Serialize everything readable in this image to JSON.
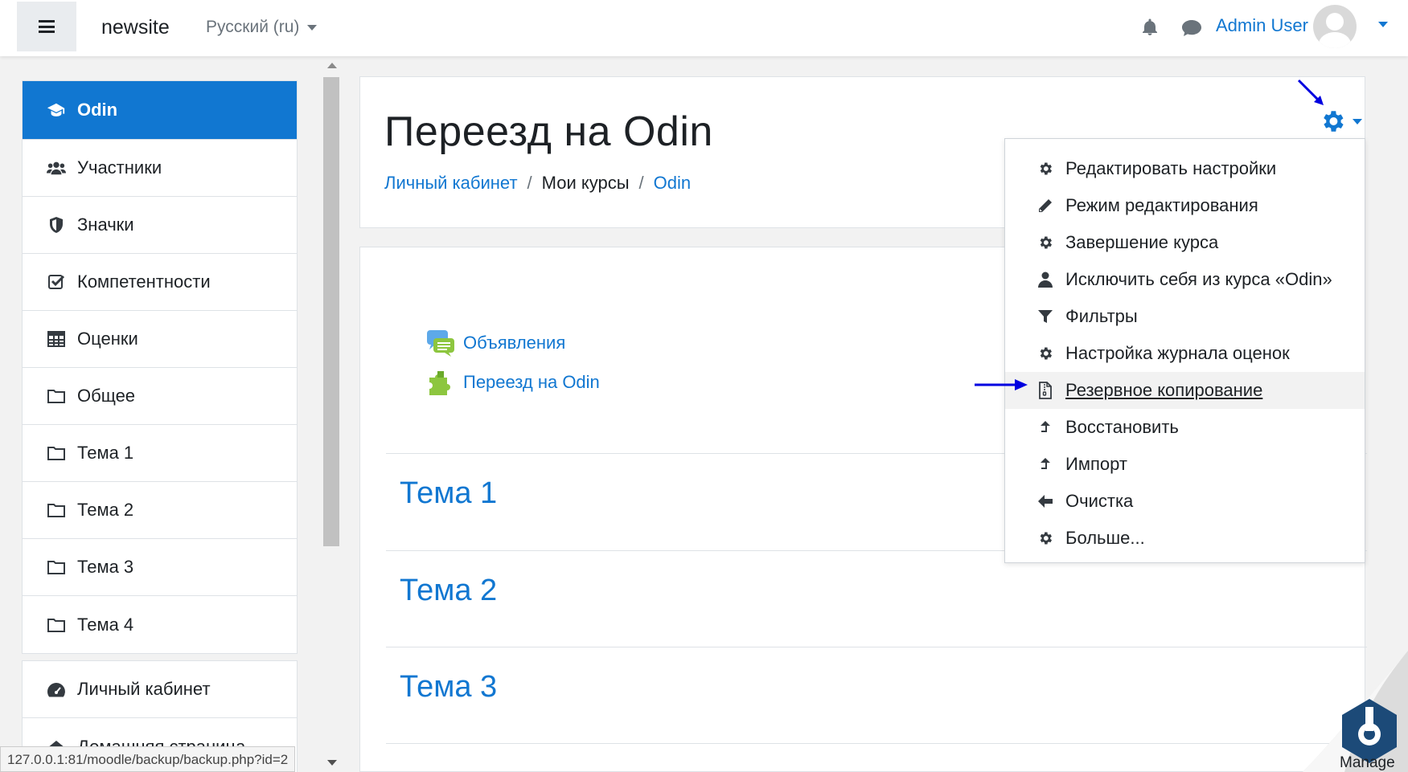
{
  "navbar": {
    "site_name": "newsite",
    "language": "Русский (ru)",
    "user_name": "Admin User"
  },
  "drawer": {
    "items": [
      {
        "label": "Odin",
        "icon": "graduation-cap-icon",
        "active": true
      },
      {
        "label": "Участники",
        "icon": "users-icon"
      },
      {
        "label": "Значки",
        "icon": "shield-icon"
      },
      {
        "label": "Компетентности",
        "icon": "check-square-icon"
      },
      {
        "label": "Оценки",
        "icon": "table-icon"
      },
      {
        "label": "Общее",
        "icon": "folder-icon"
      },
      {
        "label": "Тема 1",
        "icon": "folder-icon"
      },
      {
        "label": "Тема 2",
        "icon": "folder-icon"
      },
      {
        "label": "Тема 3",
        "icon": "folder-icon"
      },
      {
        "label": "Тема 4",
        "icon": "folder-icon"
      }
    ],
    "items2": [
      {
        "label": "Личный кабинет",
        "icon": "dashboard-icon"
      },
      {
        "label": "Домашняя страница",
        "icon": "home-icon"
      }
    ]
  },
  "status_url": "127.0.0.1:81/moodle/backup/backup.php?id=2",
  "header": {
    "title": "Переезд на Odin",
    "breadcrumb": [
      "Личный кабинет",
      "Мои курсы",
      "Odin"
    ]
  },
  "activities": [
    {
      "label": "Объявления",
      "icon": "forum-icon"
    },
    {
      "label": "Переезд на Odin",
      "icon": "puzzle-icon"
    }
  ],
  "sections": [
    "Тема 1",
    "Тема 2",
    "Тема 3"
  ],
  "menu": {
    "items": [
      {
        "label": "Редактировать настройки",
        "icon": "gear-icon"
      },
      {
        "label": "Режим редактирования",
        "icon": "pencil-icon"
      },
      {
        "label": "Завершение курса",
        "icon": "gear-icon"
      },
      {
        "label": "Исключить себя из курса «Odin»",
        "icon": "user-icon"
      },
      {
        "label": "Фильтры",
        "icon": "filter-icon"
      },
      {
        "label": "Настройка журнала оценок",
        "icon": "gear-icon"
      },
      {
        "label": "Резервное копирование",
        "icon": "file-archive-icon",
        "highlighted": true
      },
      {
        "label": "Восстановить",
        "icon": "upload-arrow-icon"
      },
      {
        "label": "Импорт",
        "icon": "upload-arrow-icon"
      },
      {
        "label": "Очистка",
        "icon": "arrow-left-icon"
      },
      {
        "label": "Больше...",
        "icon": "gear-icon"
      }
    ]
  },
  "manage_label": "Manage",
  "colors": {
    "accent": "#1177d1",
    "annotation_arrow": "#0000e0"
  }
}
